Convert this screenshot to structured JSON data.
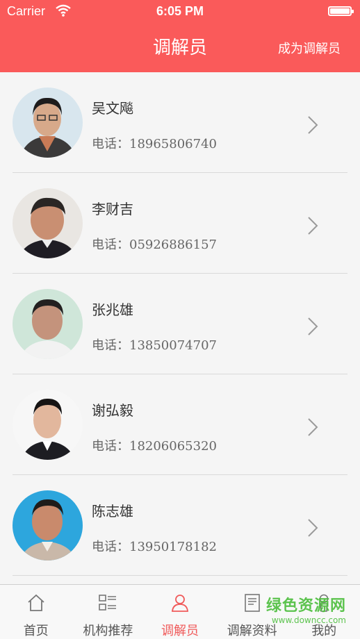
{
  "status_bar": {
    "carrier": "Carrier",
    "time": "6:05 PM"
  },
  "header": {
    "title": "调解员",
    "action": "成为调解员"
  },
  "mediators": [
    {
      "name": "吴文飚",
      "phone_label": "电话：",
      "phone": "18965806740"
    },
    {
      "name": "李财吉",
      "phone_label": "电话：",
      "phone": "05926886157"
    },
    {
      "name": "张兆雄",
      "phone_label": "电话：",
      "phone": "13850074707"
    },
    {
      "name": "谢弘毅",
      "phone_label": "电话：",
      "phone": "18206065320"
    },
    {
      "name": "陈志雄",
      "phone_label": "电话：",
      "phone": "13950178182"
    }
  ],
  "tabs": [
    {
      "label": "首页",
      "icon": "home-icon"
    },
    {
      "label": "机构推荐",
      "icon": "list-icon"
    },
    {
      "label": "调解员",
      "icon": "person-icon",
      "active": true
    },
    {
      "label": "调解资料",
      "icon": "document-icon"
    },
    {
      "label": "我的",
      "icon": "user-icon"
    }
  ],
  "watermark": {
    "text": "绿色资源网",
    "url": "www.downcc.com"
  },
  "colors": {
    "header": "#fa5a5a",
    "active_tab": "#f05a5a",
    "background": "#f5f5f5"
  }
}
